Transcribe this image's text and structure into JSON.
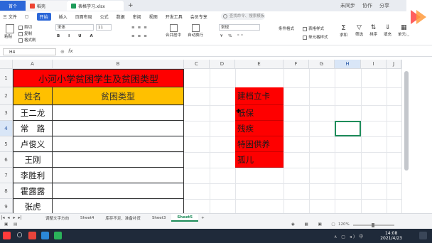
{
  "titlebar": {
    "tabs": [
      {
        "label": "首个"
      },
      {
        "label": "稻壳"
      },
      {
        "label": "表格学习.xlsx"
      }
    ],
    "right_items": [
      "未同步",
      "协作",
      "分享"
    ]
  },
  "menubar": {
    "items": [
      "三 文件",
      "开始",
      "插入",
      "页面布局",
      "公式",
      "数据",
      "审阅",
      "视图",
      "开发工具",
      "会员专享"
    ],
    "active": "开始",
    "search_placeholder": "查找命令、搜索模板"
  },
  "ribbon": {
    "paste": "粘贴",
    "cut": "剪切",
    "copy": "复制",
    "format_painter": "格式刷",
    "font": "宋体",
    "font_size": "11",
    "merge": "合并居中",
    "wrap": "自动换行",
    "number_format": "常规",
    "conditional": "条件格式",
    "cell_style": "单元格样式",
    "table_style": "表格样式",
    "sum": "求和",
    "filter": "筛选",
    "sort": "排序",
    "fill": "填充",
    "cell": "单元格"
  },
  "formula_bar": {
    "name_box": "H4",
    "fx": "fx",
    "content": ""
  },
  "columns": [
    "A",
    "B",
    "C",
    "D",
    "E",
    "F",
    "G",
    "H",
    "I",
    "J"
  ],
  "selected_column": "H",
  "rows": [
    "1",
    "2",
    "3",
    "4",
    "5",
    "6",
    "7",
    "8",
    "9"
  ],
  "selected_row": "4",
  "sheet": {
    "title": "小河小学贫困学生及贫困类型",
    "header_name": "姓名",
    "header_type": "贫困类型",
    "names": [
      "王二龙",
      "常　路",
      "卢俊义",
      "王刚",
      "李胜利",
      "霍露露",
      "张虎"
    ],
    "types": [
      "建档立卡",
      "低保",
      "残疾",
      "特困供养",
      "孤儿"
    ]
  },
  "sheet_tabs": [
    "调整文字方向",
    "Sheet4",
    "库存不足、准备补货",
    "Sheet3",
    "Sheet5"
  ],
  "active_sheet": "Sheet5",
  "status": {
    "zoom": "120%"
  },
  "taskbar": {
    "time": "14:08",
    "date": "2021/4/23"
  },
  "colors": {
    "title_red": "#fe0000",
    "header_gold": "#ffc000",
    "accent_blue": "#2c67d8",
    "select_green": "#1e8c5a"
  }
}
